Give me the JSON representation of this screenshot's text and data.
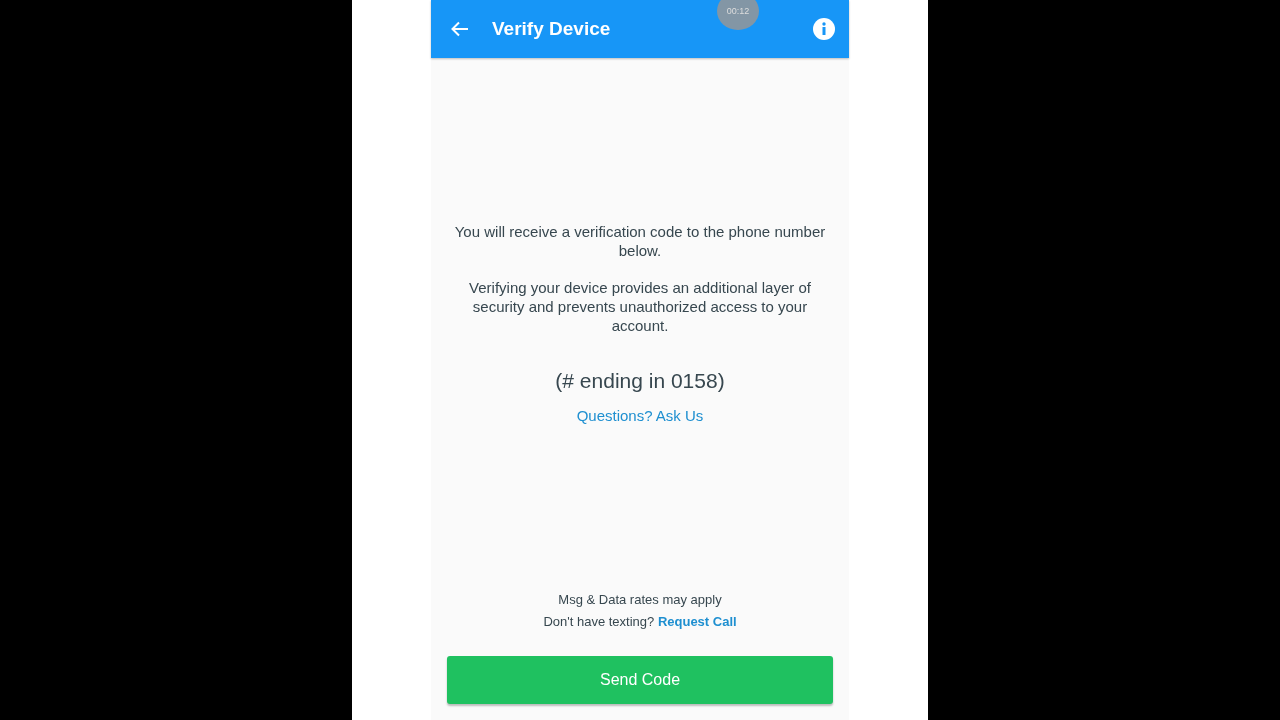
{
  "header": {
    "title": "Verify Device"
  },
  "recording_timer": "00:12",
  "intro": [
    "You will receive a verification code to the phone number below.",
    "Verifying your device provides an additional layer of security and prevents unauthorized access to your account."
  ],
  "phone_hint": "(# ending in 0158)",
  "help_link": "Questions? Ask Us",
  "footer": {
    "rates_note": "Msg & Data rates may apply",
    "call_prompt": "Don't have texting?",
    "call_link": "Request Call"
  },
  "primary_button": "Send Code"
}
